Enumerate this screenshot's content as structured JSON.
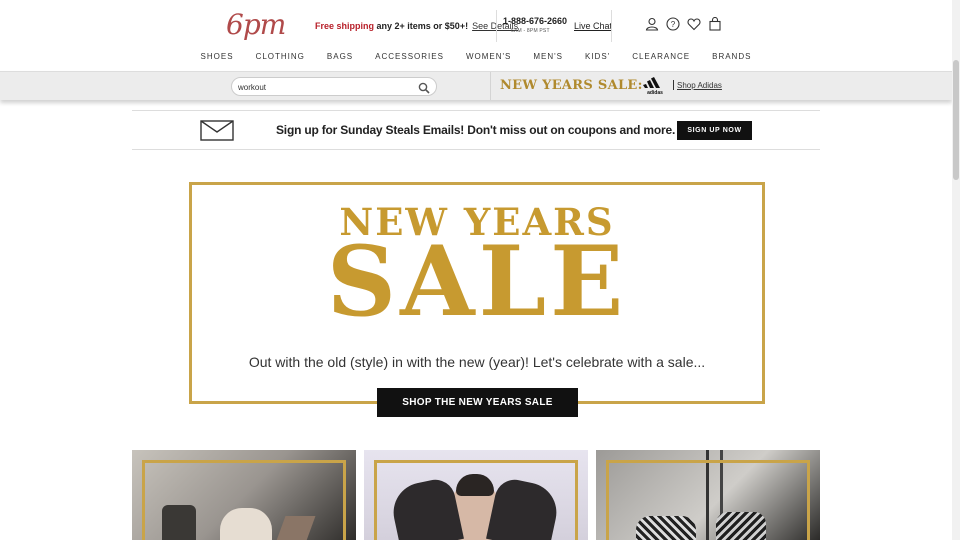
{
  "header": {
    "logo": "6pm",
    "promo_free": "Free shipping",
    "promo_rest": " any 2+ items or $50+!",
    "promo_link": "See Details",
    "phone": "1-888-676-2660",
    "hours": "6AM - 8PM PST",
    "live_chat": "Live Chat",
    "icons": [
      "user-icon",
      "help-icon",
      "heart-icon",
      "bag-icon"
    ]
  },
  "nav": {
    "items": [
      "SHOES",
      "CLOTHING",
      "BAGS",
      "ACCESSORIES",
      "WOMEN'S",
      "MEN'S",
      "KIDS'",
      "CLEARANCE",
      "BRANDS"
    ]
  },
  "search": {
    "value": "workout"
  },
  "promo_bar": {
    "sale_text": "NEW YEARS SALE:",
    "brand": "adidas",
    "link": "Shop Adidas"
  },
  "email_banner": {
    "text": "Sign up for Sunday Steals Emails! Don't miss out on coupons and more.",
    "button": "SIGN UP NOW"
  },
  "hero": {
    "title_line1": "NEW YEARS",
    "title_line2": "SALE",
    "subtitle": "Out with the old (style) in with the new (year)! Let's celebrate with a sale...",
    "button": "SHOP THE NEW YEARS SALE"
  },
  "colors": {
    "brand": "#b04a4a",
    "gold": "#c79a30",
    "promo_red": "#b8202a",
    "button_black": "#111111"
  }
}
